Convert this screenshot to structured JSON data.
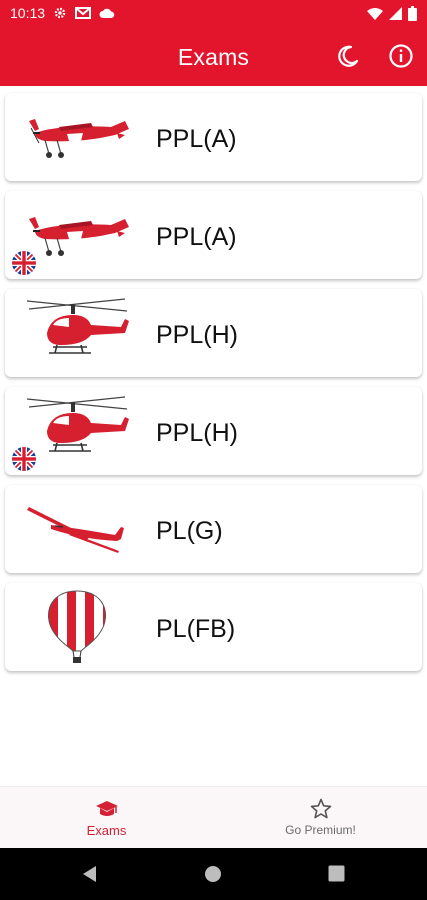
{
  "status_bar": {
    "time": "10:13"
  },
  "app_bar": {
    "title": "Exams"
  },
  "exams": [
    {
      "label": "PPL(A)",
      "icon": "airplane-icon",
      "english": false
    },
    {
      "label": "PPL(A)",
      "icon": "airplane-icon",
      "english": true
    },
    {
      "label": "PPL(H)",
      "icon": "helicopter-icon",
      "english": false
    },
    {
      "label": "PPL(H)",
      "icon": "helicopter-icon",
      "english": true
    },
    {
      "label": "PL(G)",
      "icon": "glider-icon",
      "english": false
    },
    {
      "label": "PL(FB)",
      "icon": "balloon-icon",
      "english": false
    }
  ],
  "bottom_nav": {
    "exams_label": "Exams",
    "premium_label": "Go Premium!"
  },
  "colors": {
    "primary": "#e2152d",
    "nav_active": "#d32035",
    "nav_inactive": "#6b6b6b"
  }
}
